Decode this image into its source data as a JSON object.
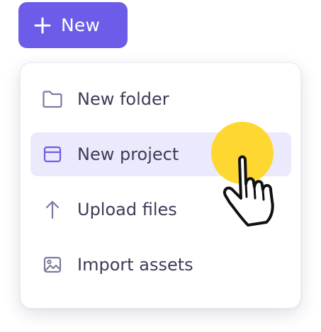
{
  "new_button": {
    "label": "New",
    "icon": "plus-icon"
  },
  "menu": {
    "items": [
      {
        "label": "New folder",
        "icon": "folder-icon",
        "active": false
      },
      {
        "label": "New project",
        "icon": "window-icon",
        "active": true
      },
      {
        "label": "Upload files",
        "icon": "arrow-up-icon",
        "active": false
      },
      {
        "label": "Import assets",
        "icon": "image-icon",
        "active": false
      }
    ]
  },
  "colors": {
    "accent": "#6c5ce7",
    "icon": "#7b7a9f",
    "text": "#3b3c58",
    "active_bg": "#ebe9fc",
    "click_highlight": "#ffd731"
  }
}
